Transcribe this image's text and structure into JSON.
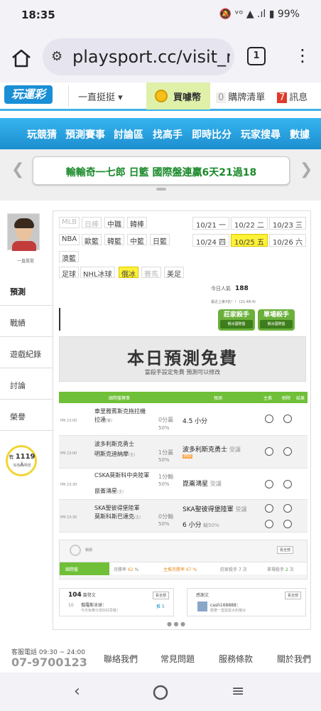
{
  "status": {
    "time": "18:35",
    "icons": "🔕 ᵛᵒ ▲ .ıl ▮ 99%"
  },
  "browser": {
    "url": "playsport.cc/visit_m",
    "tab_count": "1"
  },
  "header": {
    "logo": "玩運彩",
    "user_menu": "一直挺挺 ▾",
    "buy_coins": "買噱幣",
    "cart_count": "0",
    "cart_label": "購牌清單",
    "msg_count": "7",
    "msg_label": "訊息"
  },
  "nav": [
    "玩競猜",
    "預測賽事",
    "討論區",
    "找高手",
    "即時比分",
    "玩家搜尋",
    "數據"
  ],
  "banner": {
    "text": "輸輸奇一七郎 日籃 國際盤連贏6天21過18"
  },
  "sidebar": {
    "username": "一直挺挺",
    "items": [
      "預測",
      "戰績",
      "遊戲紀錄",
      "討論",
      "榮譽"
    ],
    "supporters_count": "1119",
    "supporters_unit": "人",
    "supporters_prefix": "有",
    "supporters_label": "加我為明燈"
  },
  "leagues": [
    {
      "label": "MLB",
      "state": "dim"
    },
    {
      "label": "日棒",
      "state": "dim"
    },
    {
      "label": "中職",
      "state": "normal"
    },
    {
      "label": "韓棒",
      "state": "normal"
    },
    {
      "label": "NBA",
      "state": "normal"
    },
    {
      "label": "歐籃",
      "state": "normal"
    },
    {
      "label": "韓籃",
      "state": "normal"
    },
    {
      "label": "中籃",
      "state": "normal"
    },
    {
      "label": "日籃",
      "state": "normal"
    },
    {
      "label": "澳籃",
      "state": "normal"
    },
    {
      "label": "足球",
      "state": "normal"
    },
    {
      "label": "NHL冰球",
      "state": "normal"
    },
    {
      "label": "俄冰",
      "state": "selected"
    },
    {
      "label": "賽馬",
      "state": "dim"
    },
    {
      "label": "美足",
      "state": "normal"
    }
  ],
  "dates": [
    {
      "label": "10/21 一",
      "state": "normal"
    },
    {
      "label": "10/22 二",
      "state": "normal"
    },
    {
      "label": "10/23 三",
      "state": "normal"
    },
    {
      "label": "10/24 四",
      "state": "normal"
    },
    {
      "label": "10/25 五",
      "state": "selected"
    },
    {
      "label": "10/26 六",
      "state": "normal"
    }
  ],
  "today_visitors_label": "今日人氣",
  "today_visitors": "188",
  "rank_note": "最近上第3名！！ (21:48:4)",
  "kings": [
    {
      "title": "莊家殺手",
      "sub": "俄冰國際盤"
    },
    {
      "title": "單場殺手",
      "sub": "俄冰國際盤"
    }
  ],
  "free_banner": {
    "title": "本日預測免費",
    "subtitle": "當殺手設定免費 預測可以修改"
  },
  "table": {
    "headers": [
      "國際盤賽事",
      "預測",
      "主推",
      "刪除",
      "結果"
    ],
    "rows": [
      {
        "time": "PM 23:00",
        "home": "車里雅賓斯克拖拉機",
        "away": "拉達",
        "away_note": "(客)",
        "handicap": "0分",
        "handicap_sub": "贏",
        "pct": "50%",
        "pick": "4.5 小分",
        "pick_note": ""
      },
      {
        "time": "PM 23:00",
        "home": "波多利斯克勇士",
        "away": "明斯克迪納摩",
        "away_note": "(主)",
        "handicap": "1分",
        "handicap_sub": "贏",
        "pct": "50%",
        "pick": "波多利斯克勇士",
        "pick_note": "受讓",
        "tag": "PRO"
      },
      {
        "time": "PM 23:30",
        "home": "CSKA莫斯科中央陸軍",
        "away": "崑崙鴻星",
        "away_note": "(主)",
        "handicap": "1分",
        "handicap_sub": "輸",
        "pct": "50%",
        "pick": "崑崙鴻星",
        "pick_note": "受讓"
      },
      {
        "time": "PM 23:30",
        "home": "SKA聖彼得堡陸軍",
        "away": "莫斯科斯巴達克",
        "away_note": "(主)",
        "handicap": "0分",
        "handicap_sub": "輸",
        "pct": "50%",
        "pick": "SKA聖彼得堡陸軍",
        "pick_note": "受讓",
        "pick2": "6 小分",
        "pick2_note": "輸50%"
      }
    ]
  },
  "records": {
    "title": "戰績",
    "more": "看全部",
    "tabs": [
      {
        "label": "國際盤"
      },
      {
        "label": "月勝率",
        "value": "62",
        "unit": "%"
      },
      {
        "label": "主推月勝率",
        "value": "67",
        "unit": "%"
      },
      {
        "label": "莊家殺手",
        "value": "7",
        "unit": "次"
      },
      {
        "label": "單場殺手",
        "value": "2",
        "unit": "次"
      }
    ]
  },
  "posts": {
    "count": "104",
    "label": "篇發文",
    "more": "看全部",
    "item_num": "10",
    "item_title": "俄羅斯冰球：",
    "item_snippet": "今天免費分享好好思喔！",
    "item_badge": "推 5"
  },
  "fans": {
    "label": "感謝文",
    "more": "看全部",
    "user": "cash168888：",
    "snippet": "跟著一直挺挺大的俄冰"
  },
  "footer": {
    "hours": "客服電話 09:30 ~ 24:00",
    "phone": "07-9700123",
    "links": [
      "聯絡我們",
      "常見問題",
      "服務條款",
      "關於我們"
    ]
  },
  "colors": {
    "brand_blue": "#1d8ecf",
    "accent_green": "#6fc038",
    "highlight_yellow": "#fff236"
  }
}
